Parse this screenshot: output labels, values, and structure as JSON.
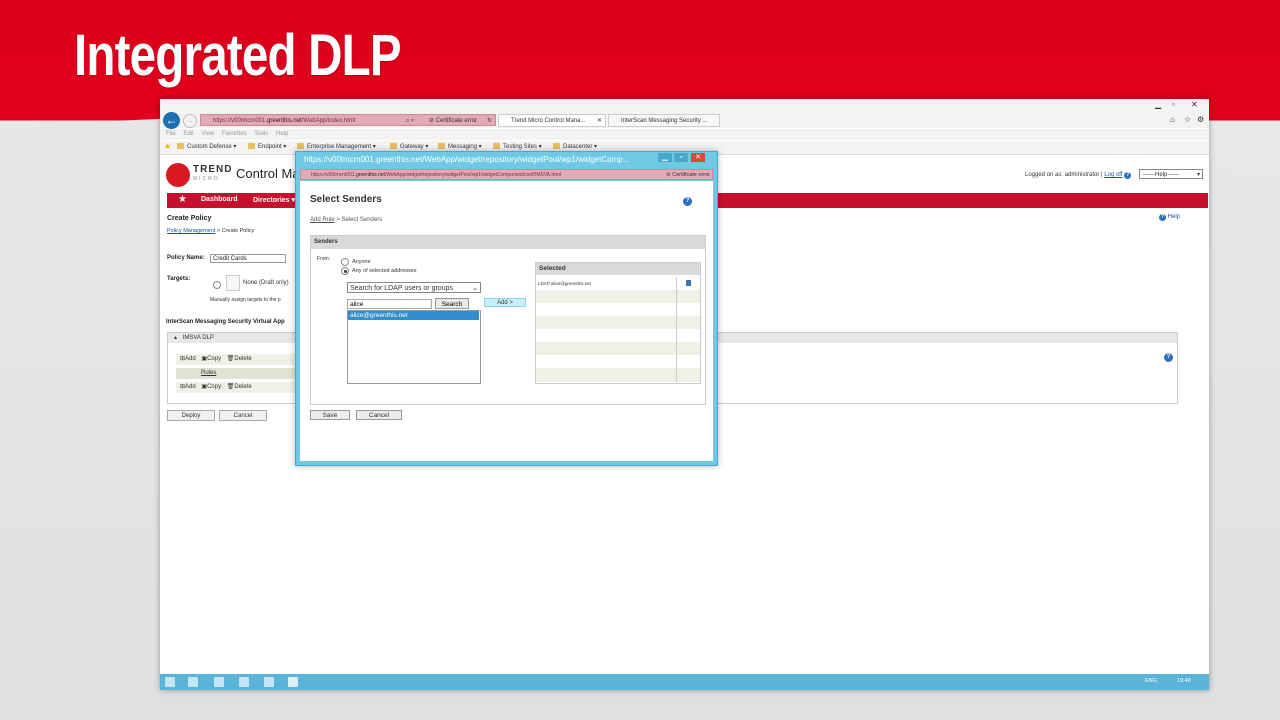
{
  "slide": {
    "title": "Integrated DLP"
  },
  "browser": {
    "url_prefix": "https://v00tmcm001.",
    "url_domain": "greenthis.net",
    "url_suffix": "/WebApp/index.html",
    "cert_error": "Certificate error",
    "tabs": [
      "Trend Micro Control Mana...",
      "InterScan Messaging Security ..."
    ],
    "menu": [
      "File",
      "Edit",
      "View",
      "Favorites",
      "Tools",
      "Help"
    ],
    "favorites": [
      "Custom Defense ▾",
      "Endpoint ▾",
      "Enterprise Management ▾",
      "Gateway ▾",
      "Messaging ▾",
      "Testing Sites ▾",
      "Datacenter ▾"
    ]
  },
  "app": {
    "brand": "TREND",
    "brand_sub": "MICRO",
    "title": "Control Ma",
    "logged_in_label": "Logged on as: administrator",
    "logoff": "Log off",
    "help_select": "------Help------",
    "nav": [
      "Dashboard",
      "Directories ▾"
    ],
    "page_title": "Create Policy",
    "help": "Help",
    "breadcrumb_link": "Policy Management",
    "breadcrumb_rest": " > Create Policy",
    "policy_name_label": "Policy Name:",
    "policy_name_value": "Credit Cards",
    "targets_label": "Targets:",
    "targets_option": "None (Draft only)",
    "targets_note": "Manually assign targets to the p",
    "section_title": "InterScan Messaging Security Virtual App",
    "panel_title": "IMSVA DLP",
    "toolbar": [
      "Add",
      "Copy",
      "Delete"
    ],
    "rules_label": "Rules",
    "deploy": "Deploy",
    "cancel": "Cancel"
  },
  "popup": {
    "window_title": "https://v00tmcm001.greenthis.net/WebApp/widget/repository/widgetPool/wp1/widgetComp...",
    "addr_prefix": "https://v00tmcm001.",
    "addr_domain": "greenthis.net",
    "addr_suffix": "/WebApp/widget/repository/widgetPool/wp1/widgetComponent/conf/IMSVA.html",
    "cert_error": "Certificate error",
    "heading": "Select Senders",
    "breadcrumb_link": "Add Rule",
    "breadcrumb_rest": " > Select Senders",
    "senders_head": "Senders",
    "from_label": "From:",
    "opt_anyone": "Anyone",
    "opt_selected": "Any of selected addresses",
    "ldap_select": "Search for LDAP users or groups",
    "search_value": "alice",
    "search_button": "Search",
    "result_item": "alice@greenthis.net",
    "add_button": "Add >",
    "selected_head": "Selected",
    "selected_items": [
      "LDAP:alice@greenthis.net"
    ],
    "save": "Save",
    "cancel": "Cancel"
  },
  "taskbar": {
    "lang": "ENG",
    "time": "19:48"
  }
}
